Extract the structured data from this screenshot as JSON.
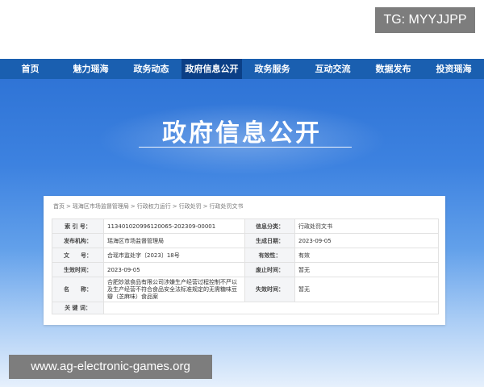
{
  "overlay": {
    "tg_tag": "TG: MYYJJPP",
    "site_url": "www.ag-electronic-games.org"
  },
  "nav": {
    "items": [
      {
        "label": "首页"
      },
      {
        "label": "魅力瑶海"
      },
      {
        "label": "政务动态"
      },
      {
        "label": "政府信息公开"
      },
      {
        "label": "政务服务"
      },
      {
        "label": "互动交流"
      },
      {
        "label": "数据发布"
      },
      {
        "label": "投资瑶海"
      }
    ],
    "active_index": 3
  },
  "banner": {
    "title": "政府信息公开"
  },
  "breadcrumb": [
    "首页",
    "瑶海区市场监督管理局",
    "行政权力运行",
    "行政处罚",
    "行政处罚文书"
  ],
  "info": {
    "index_no_label": "索 引 号：",
    "index_no": "113401020996120065-202309-00001",
    "category_label": "信息分类：",
    "category": "行政处罚文书",
    "issuer_label": "发布机构：",
    "issuer": "瑶海区市场监督管理局",
    "created_label": "生成日期：",
    "created": "2023-09-05",
    "doc_no_label": "文　　号：",
    "doc_no": "合瑶市监处字〔2023〕18号",
    "validity_label": "有效性：",
    "validity": "有效",
    "effective_label": "生效时间：",
    "effective": "2023-09-05",
    "abolished_label": "废止时间：",
    "abolished": "暂无",
    "name_label": "名　　称：",
    "name": "合肥妙滋食品有限公司涉嫌生产经营过程控制不严以及生产经营不符合食品安全法标准规定的无需糖味豆瓣（芝麻味）食品案",
    "expiry_label": "失效时间：",
    "expiry": "暂无",
    "keywords_label": "关 键 词：",
    "keywords": ""
  }
}
